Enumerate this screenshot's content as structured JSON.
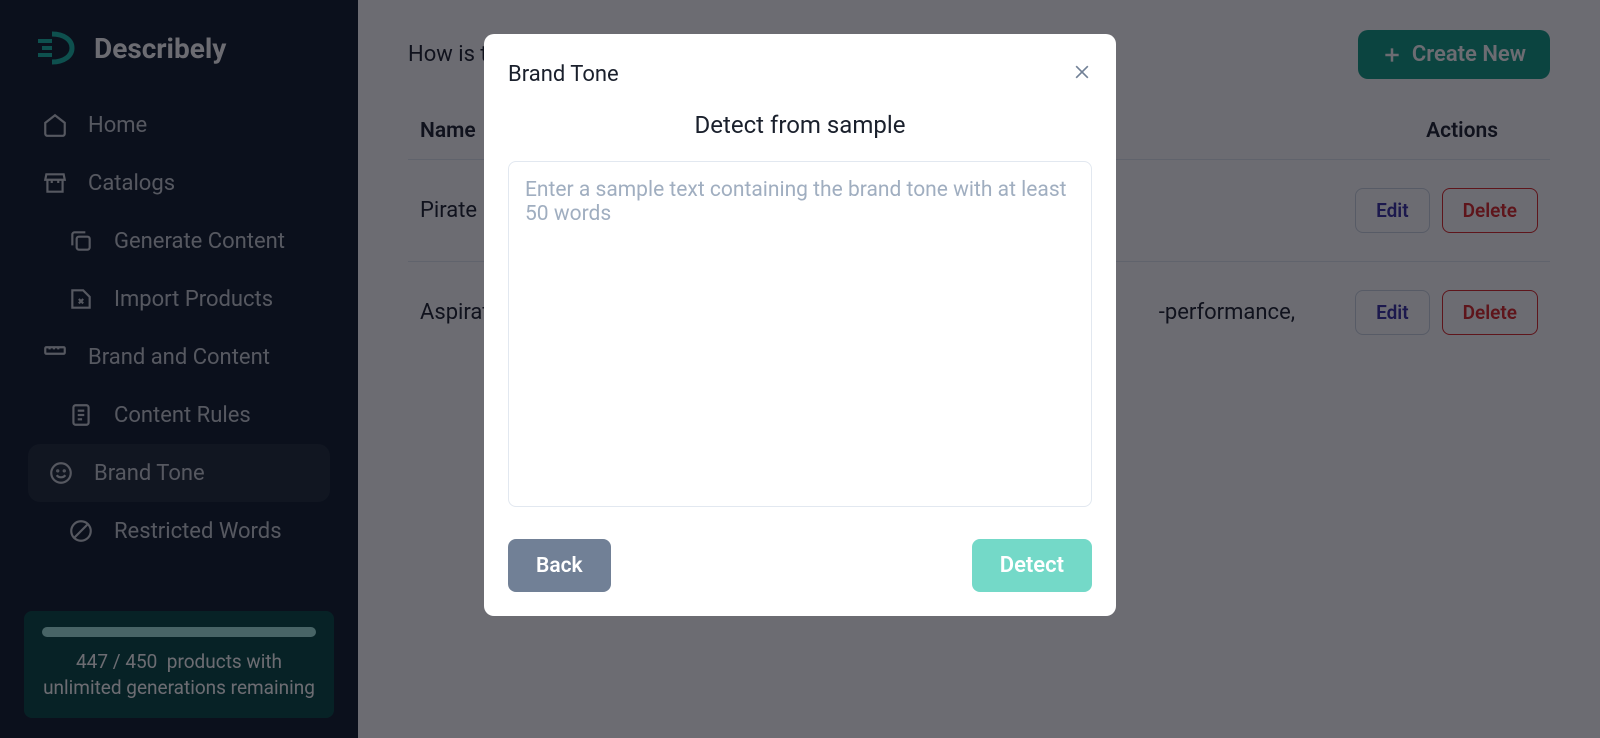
{
  "brand": {
    "name": "Describely"
  },
  "sidebar": {
    "items": [
      {
        "label": "Home"
      },
      {
        "label": "Catalogs"
      },
      {
        "label": "Generate Content"
      },
      {
        "label": "Import Products"
      },
      {
        "label": "Brand and Content"
      },
      {
        "label": "Content Rules"
      },
      {
        "label": "Brand Tone"
      },
      {
        "label": "Restricted Words"
      }
    ],
    "usage": {
      "current": "447",
      "sep": "/",
      "max": "450",
      "text": "products with unlimited generations remaining"
    }
  },
  "main": {
    "question": "How is t",
    "create_label": "Create New",
    "columns": {
      "name": "Name",
      "actions": "Actions"
    },
    "rows": [
      {
        "name": "Pirate",
        "desc": "",
        "edit": "Edit",
        "delete": "Delete"
      },
      {
        "name": "Aspirati",
        "desc": "‑performance,",
        "edit": "Edit",
        "delete": "Delete"
      }
    ]
  },
  "modal": {
    "title": "Brand Tone",
    "subtitle": "Detect from sample",
    "placeholder": "Enter a sample text containing the brand tone with at least 50 words",
    "back_label": "Back",
    "detect_label": "Detect"
  }
}
